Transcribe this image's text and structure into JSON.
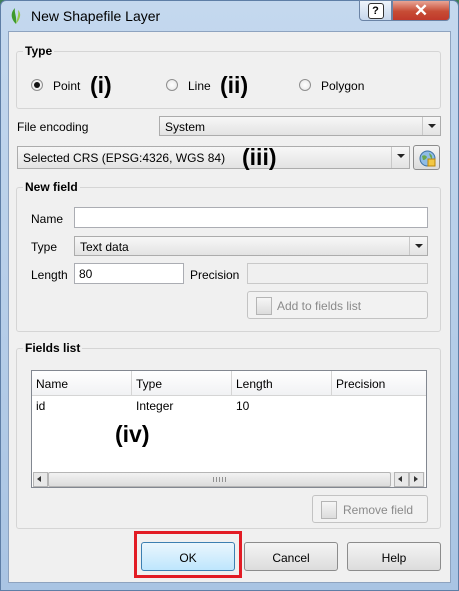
{
  "window": {
    "title": "New Shapefile Layer",
    "help_symbol": "?",
    "close_symbol": "✕"
  },
  "type_group": {
    "legend": "Type",
    "options": [
      {
        "label": "Point",
        "selected": true,
        "annotation": "(i)"
      },
      {
        "label": "Line",
        "selected": false,
        "annotation": "(ii)"
      },
      {
        "label": "Polygon",
        "selected": false,
        "annotation": ""
      }
    ]
  },
  "file_encoding": {
    "label": "File encoding",
    "value": "System"
  },
  "crs": {
    "value": "Selected CRS (EPSG:4326, WGS 84)",
    "annotation": "(iii)",
    "button_icon": "globe-crs-icon"
  },
  "new_field": {
    "legend": "New field",
    "name_label": "Name",
    "name_value": "",
    "type_label": "Type",
    "type_value": "Text data",
    "length_label": "Length",
    "length_value": "80",
    "precision_label": "Precision",
    "precision_value": "",
    "add_button": "Add to fields list"
  },
  "fields_list": {
    "legend": "Fields list",
    "columns": [
      "Name",
      "Type",
      "Length",
      "Precision"
    ],
    "rows": [
      [
        "id",
        "Integer",
        "10",
        ""
      ]
    ],
    "annotation": "(iv)",
    "remove_button": "Remove field"
  },
  "footer": {
    "ok": "OK",
    "cancel": "Cancel",
    "help": "Help"
  },
  "colors": {
    "highlight_box": "#e21b24",
    "close_button": "#c74c35",
    "dialog_background": "#f0f0f0"
  }
}
